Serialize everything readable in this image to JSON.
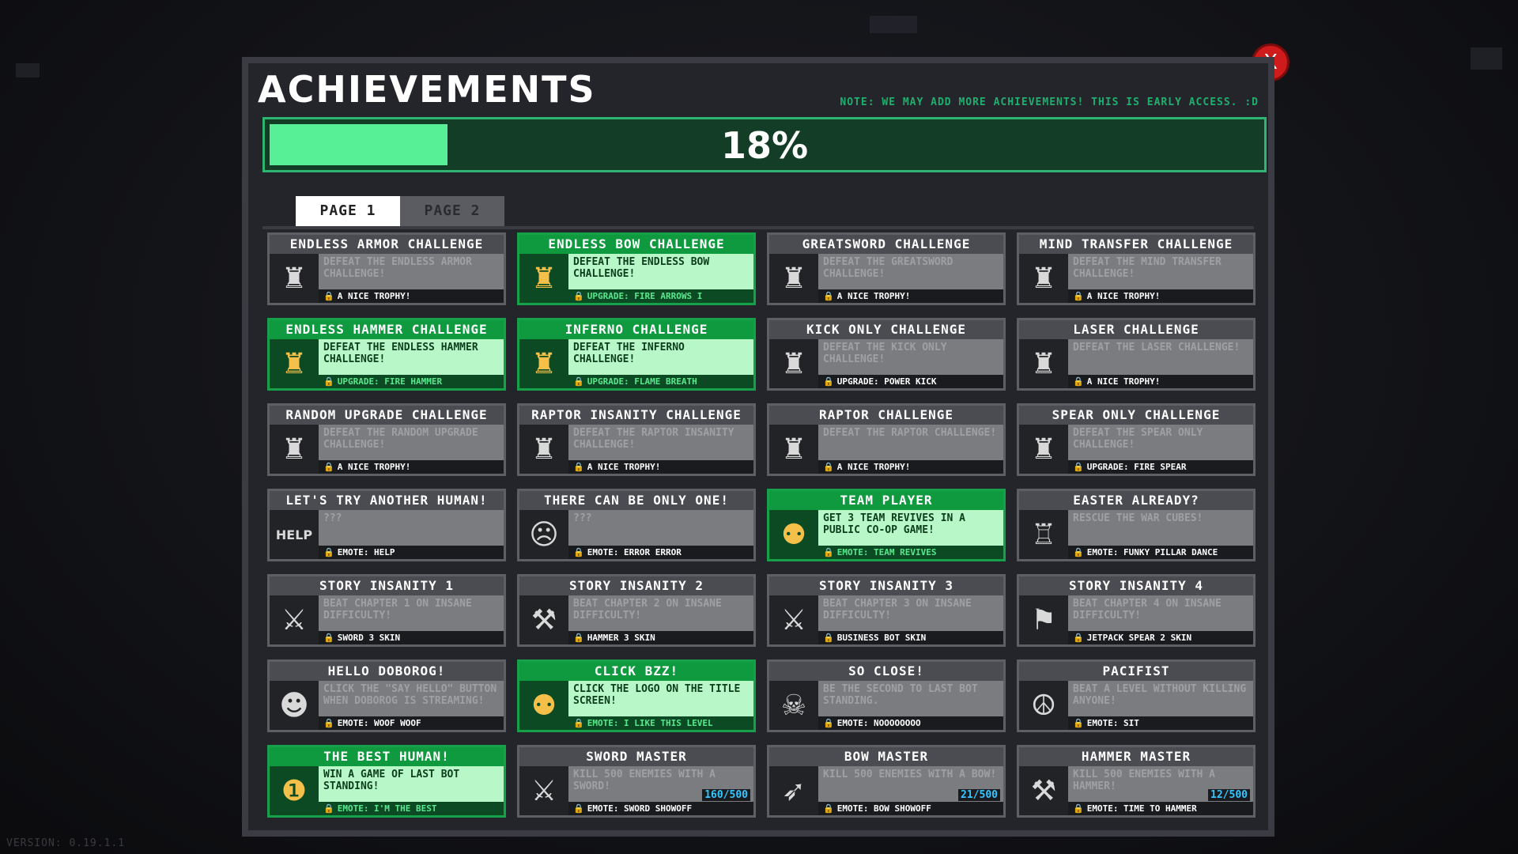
{
  "window": {
    "title": "ACHIEVEMENTS",
    "note": "NOTE: WE MAY ADD MORE ACHIEVEMENTS! THIS IS EARLY ACCESS. :D",
    "close_label": "X",
    "progress_text": "18%",
    "progress_fraction": 0.18
  },
  "tabs": [
    "PAGE 1",
    "PAGE 2"
  ],
  "version": "VERSION: 0.19.1.1",
  "achievements": [
    {
      "title": "ENDLESS ARMOR CHALLENGE",
      "desc": "DEFEAT THE ENDLESS ARMOR CHALLENGE!",
      "reward": "A NICE TROPHY!",
      "unlocked": false,
      "icon": "trophy-icon",
      "glyph": "♜"
    },
    {
      "title": "ENDLESS BOW CHALLENGE",
      "desc": "DEFEAT THE ENDLESS BOW CHALLENGE!",
      "reward": "UPGRADE: FIRE ARROWS I",
      "unlocked": true,
      "icon": "trophy-icon",
      "glyph": "♜"
    },
    {
      "title": "GREATSWORD CHALLENGE",
      "desc": "DEFEAT THE GREATSWORD CHALLENGE!",
      "reward": "A NICE TROPHY!",
      "unlocked": false,
      "icon": "trophy-icon",
      "glyph": "♜"
    },
    {
      "title": "MIND TRANSFER CHALLENGE",
      "desc": "DEFEAT THE MIND TRANSFER CHALLENGE!",
      "reward": "A NICE TROPHY!",
      "unlocked": false,
      "icon": "trophy-icon",
      "glyph": "♜"
    },
    {
      "title": "ENDLESS HAMMER CHALLENGE",
      "desc": "DEFEAT THE ENDLESS HAMMER CHALLENGE!",
      "reward": "UPGRADE: FIRE HAMMER",
      "unlocked": true,
      "icon": "trophy-icon",
      "glyph": "♜"
    },
    {
      "title": "INFERNO CHALLENGE",
      "desc": "DEFEAT THE INFERNO CHALLENGE!",
      "reward": "UPGRADE: FLAME BREATH",
      "unlocked": true,
      "icon": "trophy-icon",
      "glyph": "♜"
    },
    {
      "title": "KICK ONLY CHALLENGE",
      "desc": "DEFEAT THE KICK ONLY CHALLENGE!",
      "reward": "UPGRADE: POWER KICK",
      "unlocked": false,
      "icon": "trophy-icon",
      "glyph": "♜"
    },
    {
      "title": "LASER CHALLENGE",
      "desc": "DEFEAT THE LASER CHALLENGE!",
      "reward": "A NICE TROPHY!",
      "unlocked": false,
      "icon": "trophy-icon",
      "glyph": "♜"
    },
    {
      "title": "RANDOM UPGRADE CHALLENGE",
      "desc": "DEFEAT THE RANDOM UPGRADE CHALLENGE!",
      "reward": "A NICE TROPHY!",
      "unlocked": false,
      "icon": "trophy-icon",
      "glyph": "♜"
    },
    {
      "title": "RAPTOR INSANITY CHALLENGE",
      "desc": "DEFEAT THE RAPTOR INSANITY CHALLENGE!",
      "reward": "A NICE TROPHY!",
      "unlocked": false,
      "icon": "trophy-icon",
      "glyph": "♜"
    },
    {
      "title": "RAPTOR CHALLENGE",
      "desc": "DEFEAT THE RAPTOR CHALLENGE!",
      "reward": "A NICE TROPHY!",
      "unlocked": false,
      "icon": "trophy-icon",
      "glyph": "♜"
    },
    {
      "title": "SPEAR ONLY CHALLENGE",
      "desc": "DEFEAT THE SPEAR ONLY CHALLENGE!",
      "reward": "UPGRADE: FIRE SPEAR",
      "unlocked": false,
      "icon": "trophy-icon",
      "glyph": "♜"
    },
    {
      "title": "LET'S TRY ANOTHER HUMAN!",
      "desc": "???",
      "reward": "EMOTE: HELP",
      "unlocked": false,
      "icon": "help-sign-icon",
      "glyph": "HELP"
    },
    {
      "title": "THERE CAN BE ONLY ONE!",
      "desc": "???",
      "reward": "EMOTE: ERROR ERROR",
      "unlocked": false,
      "icon": "robot-head-icon",
      "glyph": "☹"
    },
    {
      "title": "TEAM PLAYER",
      "desc": "GET 3 TEAM REVIVES IN A PUBLIC CO-OP GAME!",
      "reward": "EMOTE: TEAM REVIVES",
      "unlocked": true,
      "icon": "team-robots-icon",
      "glyph": "⚉"
    },
    {
      "title": "EASTER ALREADY?",
      "desc": "RESCUE THE WAR CUBES!",
      "reward": "EMOTE: FUNKY PILLAR DANCE",
      "unlocked": false,
      "icon": "pillar-icon",
      "glyph": "♖"
    },
    {
      "title": "STORY INSANITY 1",
      "desc": "BEAT CHAPTER 1 ON INSANE DIFFICULTY!",
      "reward": "SWORD 3 SKIN",
      "unlocked": false,
      "icon": "sword-robot-icon",
      "glyph": "⚔"
    },
    {
      "title": "STORY INSANITY 2",
      "desc": "BEAT CHAPTER 2 ON INSANE DIFFICULTY!",
      "reward": "HAMMER 3 SKIN",
      "unlocked": false,
      "icon": "hammer-robot-icon",
      "glyph": "⚒"
    },
    {
      "title": "STORY INSANITY 3",
      "desc": "BEAT CHAPTER 3 ON INSANE DIFFICULTY!",
      "reward": "BUSINESS BOT SKIN",
      "unlocked": false,
      "icon": "business-bot-icon",
      "glyph": "⚔"
    },
    {
      "title": "STORY INSANITY 4",
      "desc": "BEAT CHAPTER 4 ON INSANE DIFFICULTY!",
      "reward": "JETPACK SPEAR 2 SKIN",
      "unlocked": false,
      "icon": "jetpack-robot-icon",
      "glyph": "⚑"
    },
    {
      "title": "HELLO DOBOROG!",
      "desc": "CLICK THE \"SAY HELLO\" BUTTON WHEN DOBOROG IS STREAMING!",
      "reward": "EMOTE: WOOF WOOF",
      "unlocked": false,
      "icon": "dog-icon",
      "glyph": "☻"
    },
    {
      "title": "CLICK BZZ!",
      "desc": "CLICK THE LOGO ON THE TITLE SCREEN!",
      "reward": "EMOTE: I LIKE THIS LEVEL",
      "unlocked": true,
      "icon": "robot-icon",
      "glyph": "⚉"
    },
    {
      "title": "SO CLOSE!",
      "desc": "BE THE SECOND TO LAST BOT STANDING.",
      "reward": "EMOTE: NOOOOOOOO",
      "unlocked": false,
      "icon": "robot-falling-icon",
      "glyph": "☠"
    },
    {
      "title": "PACIFIST",
      "desc": "BEAT A LEVEL WITHOUT KILLING ANYONE!",
      "reward": "EMOTE: SIT",
      "unlocked": false,
      "icon": "sitting-robot-icon",
      "glyph": "☮"
    },
    {
      "title": "THE BEST HUMAN!",
      "desc": "WIN A GAME OF LAST BOT STANDING!",
      "reward": "EMOTE: I'M THE BEST",
      "unlocked": true,
      "icon": "ribbon-icon",
      "glyph": "❶"
    },
    {
      "title": "SWORD MASTER",
      "desc": "KILL 500 ENEMIES WITH A SWORD!",
      "reward": "EMOTE: SWORD SHOWOFF",
      "unlocked": false,
      "icon": "sword-icon",
      "glyph": "⚔",
      "count": "160/500"
    },
    {
      "title": "BOW MASTER",
      "desc": "KILL 500 ENEMIES WITH A BOW!",
      "reward": "EMOTE: BOW SHOWOFF",
      "unlocked": false,
      "icon": "bow-icon",
      "glyph": "➶",
      "count": "21/500"
    },
    {
      "title": "HAMMER MASTER",
      "desc": "KILL 500 ENEMIES WITH A HAMMER!",
      "reward": "EMOTE: TIME TO HAMMER",
      "unlocked": false,
      "icon": "hammer-icon",
      "glyph": "⚒",
      "count": "12/500"
    }
  ]
}
